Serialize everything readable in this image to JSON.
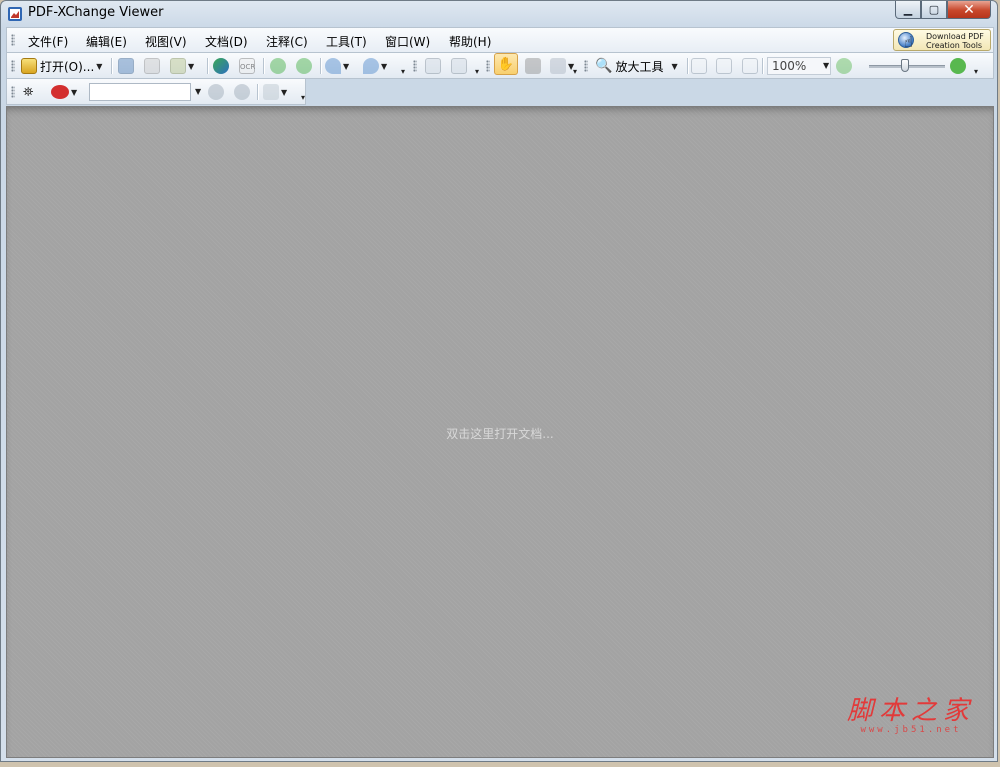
{
  "window": {
    "title": "PDF-XChange Viewer"
  },
  "menu": {
    "items": [
      "文件(F)",
      "编辑(E)",
      "视图(V)",
      "文档(D)",
      "注释(C)",
      "工具(T)",
      "窗口(W)",
      "帮助(H)"
    ],
    "download_line1": "Download PDF",
    "download_line2": "Creation Tools"
  },
  "toolbar": {
    "open_label": "打开(O)...",
    "ocr_label": "OCR",
    "zoom_tool_label": "放大工具",
    "zoom_value": "100%"
  },
  "toolbar2": {
    "search_value": ""
  },
  "workspace": {
    "hint": "双击这里打开文档..."
  },
  "watermark": {
    "main": "脚本之家",
    "sub": "www.jb51.net"
  },
  "colors": {
    "accent": "#3d79c4",
    "workspace_bg": "#a3a3a3",
    "watermark": "#e23a3a"
  }
}
